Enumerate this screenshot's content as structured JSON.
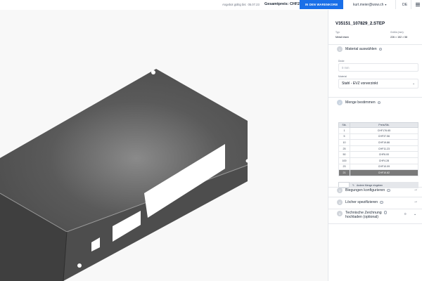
{
  "topbar": {
    "valid_label": "Angebot gültig bis:",
    "valid_date": "05.07.23",
    "total_label": "Gesamtpreis:",
    "total_value": "CHF227.14",
    "cart_button": "IN DEN WARENKORB",
    "user_email": "kurt.meier@wsw.ch",
    "language": "DE",
    "menu_icon": "hamburger-icon"
  },
  "panel": {
    "file_name": "V35151_107829_2.STEP",
    "type_label": "Typ:",
    "type_value": "Metall eisen",
    "size_label": "Größe (mm):",
    "size_value": "226 × 152 × 58",
    "step1": {
      "num": "1",
      "label": "Material auswählen"
    },
    "thickness": {
      "label": "Dicke",
      "placeholder": "0 mm"
    },
    "material": {
      "label": "Material",
      "value": "Stahl - EVZ vorverzinkt"
    },
    "step2": {
      "num": "✓",
      "label": "Menge bestimmen"
    },
    "qty_table": {
      "headers": [
        "Stk.",
        "Preis/Stk."
      ],
      "rows": [
        [
          "1",
          "CHF176.65"
        ],
        [
          "5",
          "CHF37.56"
        ],
        [
          "10",
          "CHF19.86"
        ],
        [
          "25",
          "CHF11.23"
        ],
        [
          "50",
          "CHF6.00"
        ],
        [
          "100",
          "CHF4.28"
        ],
        [
          "23",
          "CHF10.09"
        ],
        [
          "21",
          "CHF10.82"
        ]
      ],
      "selected_row": 7,
      "own_qty_button": "Andere Menge eingeben"
    },
    "step3": {
      "num": "3",
      "label": "Biegungen konfigurieren"
    },
    "step4": {
      "num": "4",
      "label": "Löcher spezifizieren"
    },
    "step5": {
      "num": "5",
      "label_line1": "Technische Zeichnung",
      "label_line2": "hochladen (optional)",
      "extra": "0"
    }
  },
  "colors": {
    "accent": "#1a6fe8",
    "selected_row": "#7a7a7a",
    "model_gray": "#505050"
  }
}
